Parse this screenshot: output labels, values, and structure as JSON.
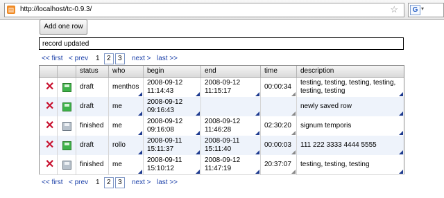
{
  "browser": {
    "url": "http://localhost/tc-0.9.3/",
    "favicon": "html",
    "star_icon": "☆",
    "search_engine": "G",
    "search_caret": "▾"
  },
  "toolbar": {
    "add_label": "Add one row"
  },
  "status": {
    "message": "record updated"
  },
  "pager": {
    "first": "<< first",
    "prev": "< prev",
    "pages": [
      "1",
      "2",
      "3"
    ],
    "next": "next >",
    "last": "last >>"
  },
  "table": {
    "headers": [
      "status",
      "who",
      "begin",
      "end",
      "time",
      "description"
    ],
    "delete_icon": "✕",
    "rows": [
      {
        "status": "draft",
        "who": "menthos",
        "begin": "2008-09-12 11:14:43",
        "end": "2008-09-12 11:15:17",
        "time": "00:00:34",
        "description": "testing, testing, testing, testing, testing, testing"
      },
      {
        "status": "draft",
        "who": "me",
        "begin": "2008-09-12 09:16:43",
        "end": "",
        "time": "",
        "description": "newly saved row"
      },
      {
        "status": "finished",
        "who": "me",
        "begin": "2008-09-12 09:16:08",
        "end": "2008-09-12 11:46:28",
        "time": "02:30:20",
        "description": "signum temporis"
      },
      {
        "status": "draft",
        "who": "rollo",
        "begin": "2008-09-11 15:11:37",
        "end": "2008-09-11 15:11:40",
        "time": "00:00:03",
        "description": "111 222 3333 4444 5555"
      },
      {
        "status": "finished",
        "who": "me",
        "begin": "2008-09-11 15:10:12",
        "end": "2008-09-12 11:47:19",
        "time": "20:37:07",
        "description": "testing, testing, testing"
      }
    ]
  },
  "colors": {
    "link": "#1a3fa8",
    "row_alt": "#eef3fb",
    "delete": "#c8102e",
    "save": "#3eb24a"
  }
}
